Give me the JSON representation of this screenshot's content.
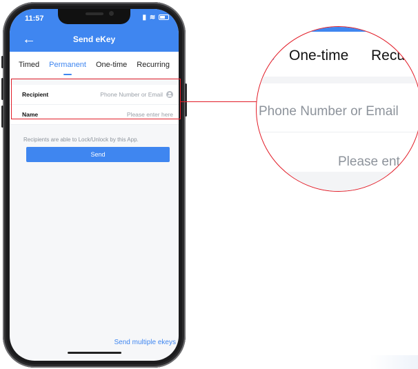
{
  "status_bar": {
    "time": "11:57"
  },
  "header": {
    "title": "Send eKey"
  },
  "tabs": [
    {
      "label": "Timed",
      "active": false
    },
    {
      "label": "Permanent",
      "active": true
    },
    {
      "label": "One-time",
      "active": false
    },
    {
      "label": "Recurring",
      "active": false
    }
  ],
  "form": {
    "recipient_label": "Recipient",
    "recipient_placeholder": "Phone Number or Email",
    "name_label": "Name",
    "name_placeholder": "Please enter here"
  },
  "note": "Recipients are able to Lock/Unlock by this App.",
  "send_button": "Send",
  "send_multiple": "Send multiple ekeys",
  "magnifier": {
    "tab_one": "One-time",
    "tab_two": "Recu",
    "placeholder_one": "Phone Number or Email",
    "placeholder_two": "Please ent"
  },
  "colors": {
    "accent": "#3f86f0",
    "highlight": "#e21c27"
  },
  "icons": [
    "back-arrow-icon",
    "wifi-icon",
    "battery-icon",
    "contact-icon"
  ]
}
